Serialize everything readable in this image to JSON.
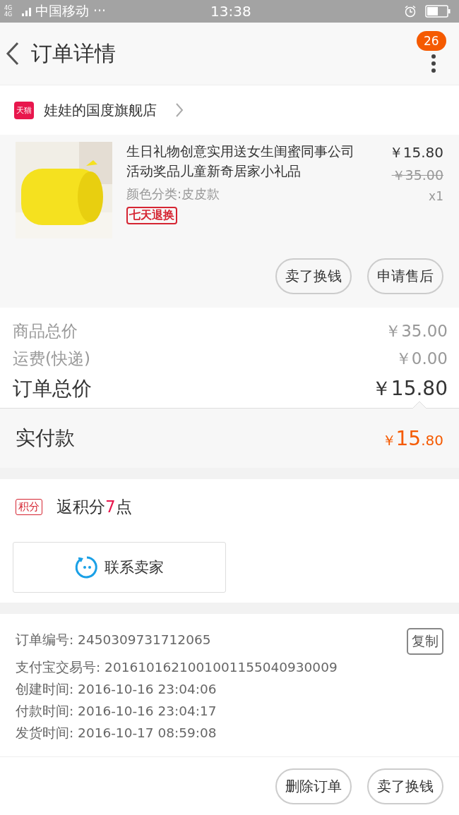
{
  "status_bar": {
    "network": "4G 4G",
    "carrier": "中国移动 ···",
    "time": "13:38"
  },
  "header": {
    "title": "订单详情",
    "badge": "26"
  },
  "store": {
    "badge": "天猫",
    "name": "娃娃的国度旗舰店"
  },
  "product": {
    "title": "生日礼物创意实用送女生闺蜜同事公司活动奖品儿童新奇居家小礼品",
    "variant": "颜色分类:皮皮款",
    "tag": "七天退换",
    "price": "￥15.80",
    "original_price": "￥35.00",
    "quantity": "x1",
    "buttons": [
      "卖了换钱",
      "申请售后"
    ]
  },
  "summary": [
    {
      "label": "商品总价",
      "value": "￥35.00",
      "kind": "minor"
    },
    {
      "label": "运费(快递)",
      "value": "￥0.00",
      "kind": "minor"
    },
    {
      "label": "订单总价",
      "value": "￥15.80",
      "kind": "total"
    }
  ],
  "paid": {
    "label": "实付款",
    "currency": "￥",
    "integer": "15",
    "decimal": ".80"
  },
  "points": {
    "badge": "积分",
    "prefix": "返积分",
    "value": "7",
    "suffix": "点"
  },
  "contact_button": "联系卖家",
  "order_info": {
    "copy_button": "复制",
    "lines": [
      {
        "label": "订单编号:",
        "value": "2450309731712065"
      },
      {
        "label": "支付宝交易号:",
        "value": "2016101621001001155040930009"
      },
      {
        "label": "创建时间:",
        "value": "2016-10-16 23:04:06"
      },
      {
        "label": "付款时间:",
        "value": "2016-10-16 23:04:17"
      },
      {
        "label": "发货时间:",
        "value": "2016-10-17 08:59:08"
      }
    ]
  },
  "bottom_buttons": [
    "删除订单",
    "卖了换钱"
  ]
}
